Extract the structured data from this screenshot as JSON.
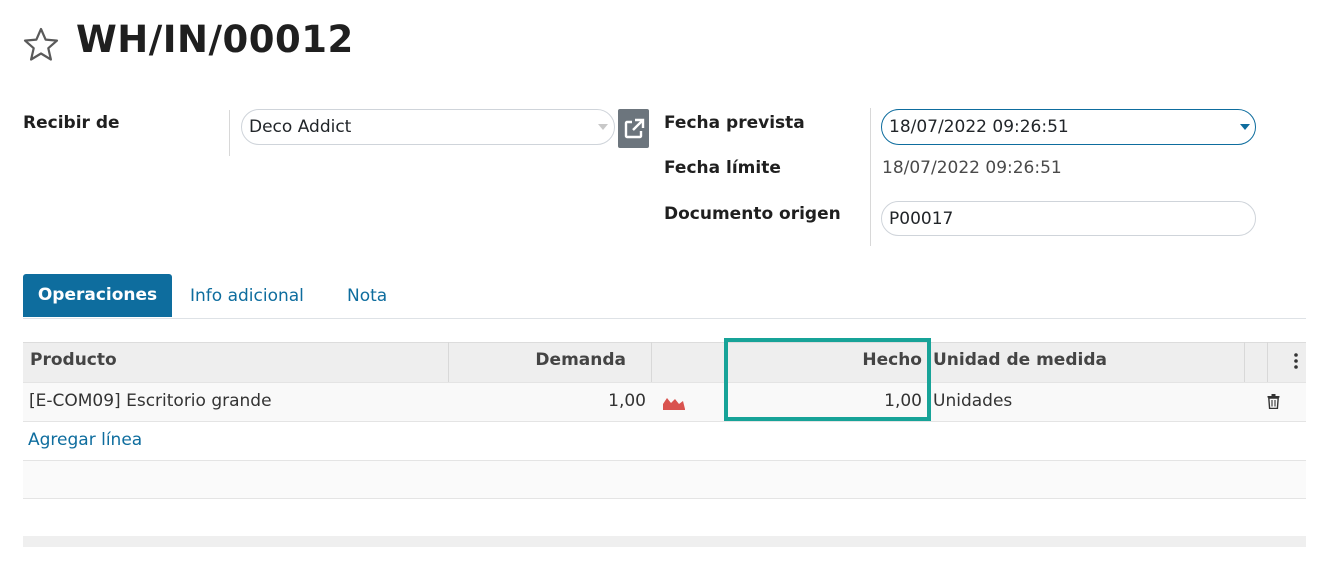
{
  "record": {
    "title": "WH/IN/00012"
  },
  "form": {
    "receive_from_label": "Recibir de",
    "receive_from_value": "Deco Addict",
    "scheduled_date_label": "Fecha prevista",
    "scheduled_date_value": "18/07/2022 09:26:51",
    "deadline_label": "Fecha límite",
    "deadline_value": "18/07/2022 09:26:51",
    "source_doc_label": "Documento origen",
    "source_doc_value": "P00017"
  },
  "tabs": [
    {
      "label": "Operaciones",
      "active": true
    },
    {
      "label": "Info adicional",
      "active": false
    },
    {
      "label": "Nota",
      "active": false
    }
  ],
  "table": {
    "headers": {
      "product": "Producto",
      "demand": "Demanda",
      "done": "Hecho",
      "uom": "Unidad de medida"
    },
    "rows": [
      {
        "product": "[E-COM09] Escritorio grande",
        "demand": "1,00",
        "done": "1,00",
        "uom": "Unidades"
      }
    ],
    "add_line": "Agregar línea"
  },
  "icons": {
    "favorite": "star-icon",
    "external_link": "external-link-icon",
    "forecast": "area-chart-icon",
    "delete": "trash-icon",
    "options": "kebab-menu-icon"
  },
  "colors": {
    "accent": "#0e6d9e",
    "highlight": "#17a398",
    "forecast": "#d9534f"
  }
}
